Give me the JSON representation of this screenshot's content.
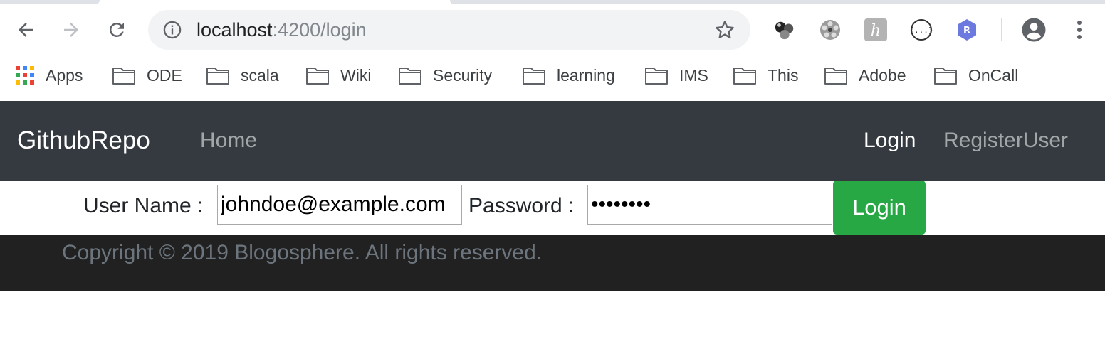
{
  "browser": {
    "url_host": "localhost",
    "url_rest": ":4200/login",
    "bookmarks": [
      "Apps",
      "ODE",
      "scala",
      "Wiki",
      "Security",
      "learning",
      "IMS",
      "This",
      "Adobe",
      "OnCall"
    ],
    "extensions": [
      "balls-icon",
      "film-reel-icon",
      "h-icon",
      "json-braces-icon",
      "r-badge-icon"
    ]
  },
  "navbar": {
    "brand": "GithubRepo",
    "home": "Home",
    "login": "Login",
    "register": "RegisterUser"
  },
  "login_form": {
    "username_label": "User Name :",
    "username_value": "johndoe@example.com",
    "password_label": "Password :",
    "password_value": "password",
    "submit_label": "Login"
  },
  "footer": {
    "copyright": "Copyright © 2019 Blogosphere. All rights reserved."
  },
  "colors": {
    "navbar_bg": "#343a40",
    "footer_bg": "#212121",
    "login_button": "#28a745"
  }
}
